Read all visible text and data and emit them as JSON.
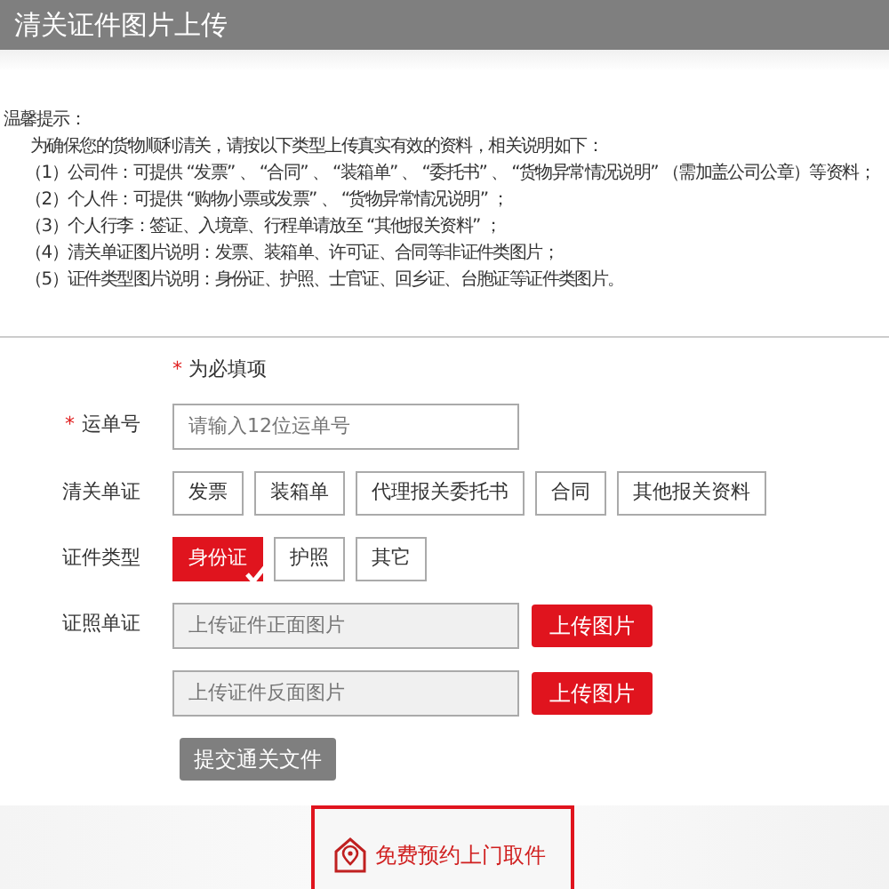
{
  "header": {
    "title": "清关证件图片上传"
  },
  "notice": {
    "heading": "温馨提示：",
    "intro": "为确保您的货物顺利清关，请按以下类型上传真实有效的资料，相关说明如下：",
    "items": [
      "（1）公司件：可提供 “发票” 、 “合同” 、 “装箱单” 、 “委托书” 、 “货物异常情况说明” （需加盖公司公章）等资料；",
      "（2）个人件：可提供 “购物小票或发票” 、 “货物异常情况说明” ；",
      "（3）个人行李：签证、入境章、行程单请放至 “其他报关资料” ；",
      "（4）清关单证图片说明：发票、装箱单、许可证、合同等非证件类图片；",
      "（5）证件类型图片说明：身份证、护照、士官证、回乡证、台胞证等证件类图片。"
    ]
  },
  "form": {
    "required_mark": "*",
    "required_note": "为必填项",
    "waybill": {
      "label": "运单号",
      "required": true,
      "placeholder": "请输入12位运单号"
    },
    "documents": {
      "label": "清关单证",
      "options": [
        {
          "label": "发票",
          "selected": false
        },
        {
          "label": "装箱单",
          "selected": false
        },
        {
          "label": "代理报关委托书",
          "selected": false
        },
        {
          "label": "合同",
          "selected": false
        },
        {
          "label": "其他报关资料",
          "selected": false
        }
      ]
    },
    "id_type": {
      "label": "证件类型",
      "options": [
        {
          "label": "身份证",
          "selected": true
        },
        {
          "label": "护照",
          "selected": false
        },
        {
          "label": "其它",
          "selected": false
        }
      ]
    },
    "id_docs": {
      "label": "证照单证",
      "uploads": [
        {
          "placeholder": "上传证件正面图片",
          "button": "上传图片"
        },
        {
          "placeholder": "上传证件反面图片",
          "button": "上传图片"
        }
      ]
    },
    "submit": "提交通关文件"
  },
  "pickup": {
    "label": "免费预约上门取件"
  }
}
